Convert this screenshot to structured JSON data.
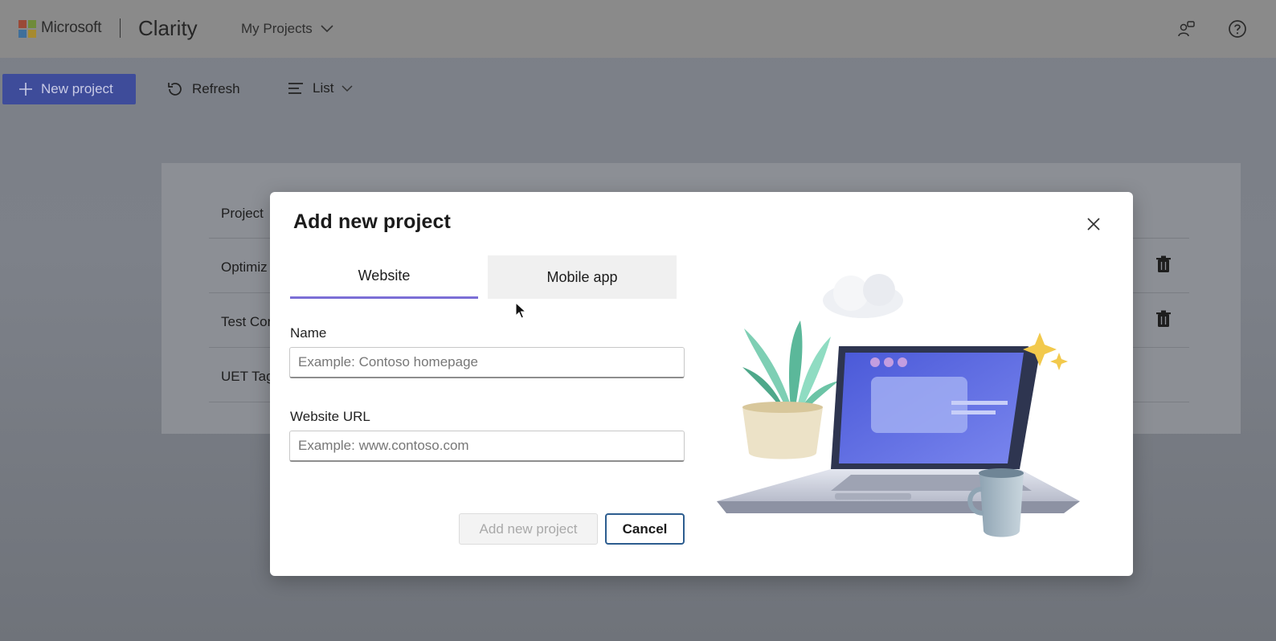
{
  "header": {
    "brand": "Microsoft",
    "product": "Clarity",
    "projects_dropdown": "My Projects"
  },
  "toolbar": {
    "new_project": "New project",
    "refresh": "Refresh",
    "view": "List"
  },
  "background_list": {
    "header": "Project",
    "rows": [
      "Optimiz",
      "Test Cor",
      "UET Tag"
    ]
  },
  "modal": {
    "title": "Add new project",
    "tabs": [
      {
        "label": "Website",
        "selected": true
      },
      {
        "label": "Mobile app",
        "selected": false
      }
    ],
    "name_label": "Name",
    "name_placeholder": "Example: Contoso homepage",
    "url_label": "Website URL",
    "url_placeholder": "Example: www.contoso.com",
    "add_button": "Add new project",
    "cancel_button": "Cancel"
  },
  "colors": {
    "accent_tab": "#7b6fd6",
    "primary_button": "#3e4c9a",
    "cancel_border": "#2d5d8f"
  }
}
